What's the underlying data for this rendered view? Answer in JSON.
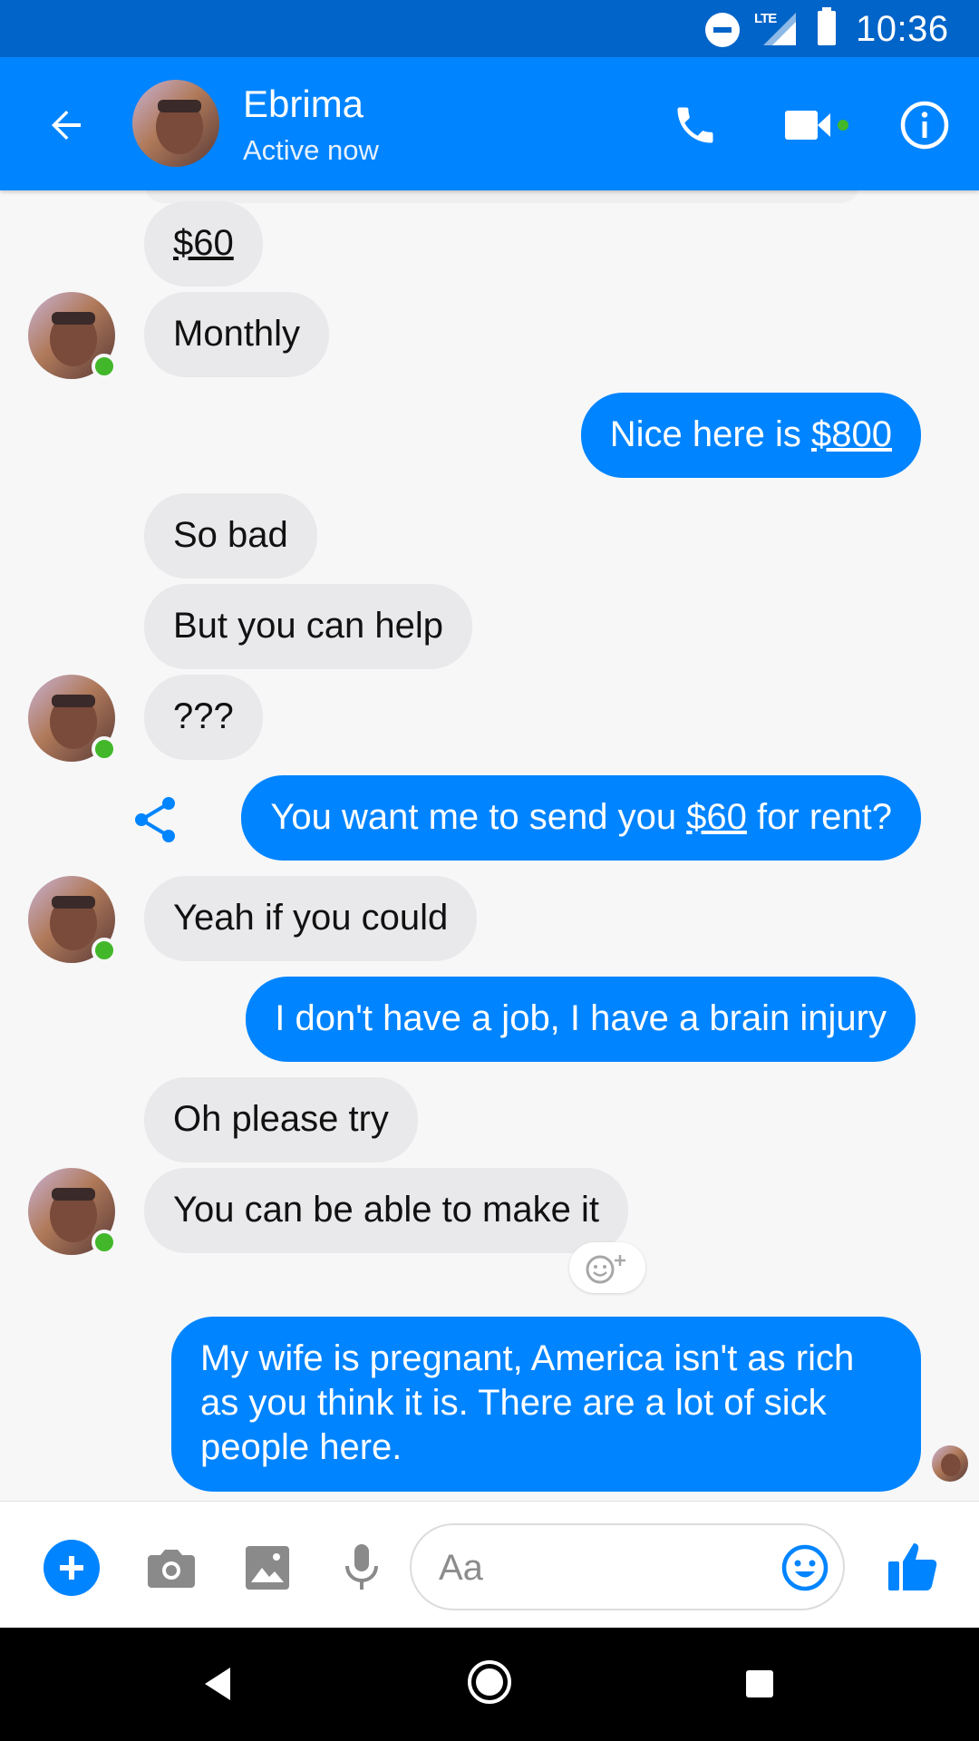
{
  "status_bar": {
    "network": "LTE",
    "time": "10:36"
  },
  "header": {
    "contact_name": "Ebrima",
    "contact_status": "Active now",
    "icons": [
      "back-arrow-icon",
      "phone-icon",
      "video-camera-icon",
      "info-icon"
    ]
  },
  "thread": {
    "messages": [
      {
        "from": "them",
        "text": "$60",
        "underlined": "$60"
      },
      {
        "from": "them",
        "text": "Monthly"
      },
      {
        "from": "me",
        "prefix": "Nice here is ",
        "link": "$800"
      },
      {
        "from": "them",
        "text": "So bad"
      },
      {
        "from": "them",
        "text": "But you can help"
      },
      {
        "from": "them",
        "text": "???"
      },
      {
        "from": "me",
        "prefix": "You want me to send you ",
        "link": "$60",
        "suffix": " for rent?"
      },
      {
        "from": "them",
        "text": "Yeah if you could"
      },
      {
        "from": "me",
        "text": "I don't have a job, I have a brain injury"
      },
      {
        "from": "them",
        "text": "Oh please try"
      },
      {
        "from": "them",
        "text": "You can be able to make it"
      },
      {
        "from": "me",
        "line1": "My wife is pregnant, America isn't as rich",
        "line2": "as you think it is. There are a lot of sick",
        "line3": "people here."
      }
    ]
  },
  "composer": {
    "placeholder": "Aa",
    "value": "",
    "icons": [
      "plus-icon",
      "camera-icon",
      "image-icon",
      "microphone-icon",
      "emoji-icon",
      "thumbs-up-icon"
    ]
  },
  "colors": {
    "brand_blue": "#0084ff",
    "status_bar_blue": "#0064c8",
    "incoming_bubble": "#e9e9eb",
    "online_green": "#42b72a"
  }
}
